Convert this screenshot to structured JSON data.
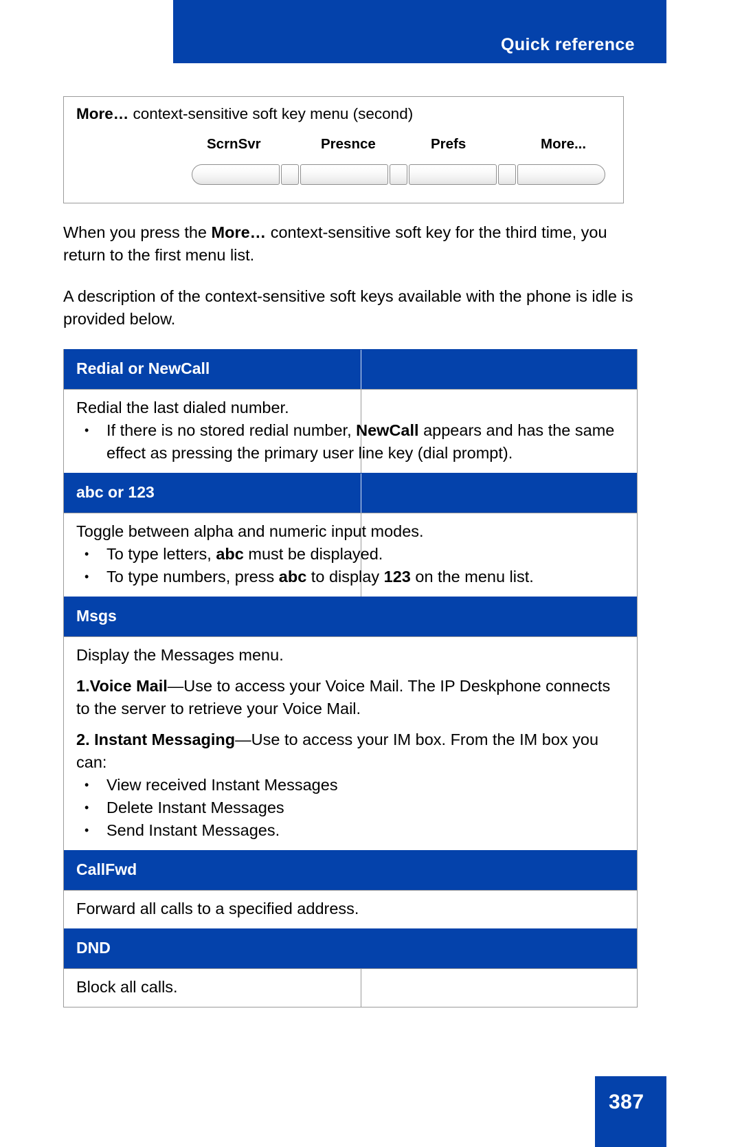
{
  "header": {
    "title": "Quick reference",
    "accent_color": "#0442ab"
  },
  "softkey_figure": {
    "caption_bold": "More…",
    "caption_rest": " context-sensitive soft key menu (second)",
    "labels": [
      "ScrnSvr",
      "Presnce",
      "Prefs",
      "More..."
    ]
  },
  "paragraphs": {
    "p1_a": "When you press the ",
    "p1_b": "More…",
    "p1_c": " context-sensitive soft key for the third time, you return to the first menu list.",
    "p2": "A description of the context-sensitive soft keys available with the phone is idle is provided below."
  },
  "table": {
    "rows": [
      {
        "type": "header",
        "title": "Redial or NewCall",
        "divider": true
      },
      {
        "type": "body",
        "divider": true,
        "lead": "Redial the last dialed number.",
        "bullets": [
          {
            "a": "If there is no stored redial number, ",
            "b": "NewCall",
            "c": " appears and has the same effect as pressing the primary user line key (dial prompt)."
          }
        ]
      },
      {
        "type": "header",
        "title": "abc or 123",
        "divider": true
      },
      {
        "type": "body",
        "divider": true,
        "lead": "Toggle between alpha and numeric input modes.",
        "bullets": [
          {
            "a": "To type letters, ",
            "b": "abc",
            "c": " must be displayed."
          },
          {
            "a": "To type numbers, press ",
            "b": "abc",
            "c": " to display ",
            "d": "123",
            "e": " on the menu list."
          }
        ]
      },
      {
        "type": "header",
        "title": "Msgs",
        "divider": false
      },
      {
        "type": "body",
        "divider": false,
        "lead": "Display the Messages menu.",
        "item1_bold": "1.Voice Mail",
        "item1_rest": "—Use to access your Voice Mail. The IP Deskphone connects to the server to retrieve your Voice Mail.",
        "item2_bold": "2. Instant Messaging",
        "item2_rest": "—Use to access your IM box. From the IM box you can:",
        "bullets": [
          {
            "a": "View received Instant Messages"
          },
          {
            "a": "Delete Instant Messages"
          },
          {
            "a": "Send Instant Messages."
          }
        ]
      },
      {
        "type": "header",
        "title": "CallFwd",
        "divider": false
      },
      {
        "type": "body",
        "divider": false,
        "lead": "Forward all calls to a specified address."
      },
      {
        "type": "header",
        "title": "DND",
        "divider": false
      },
      {
        "type": "body",
        "divider": true,
        "lead": "Block all calls."
      }
    ]
  },
  "footer": {
    "page_number": "387"
  }
}
